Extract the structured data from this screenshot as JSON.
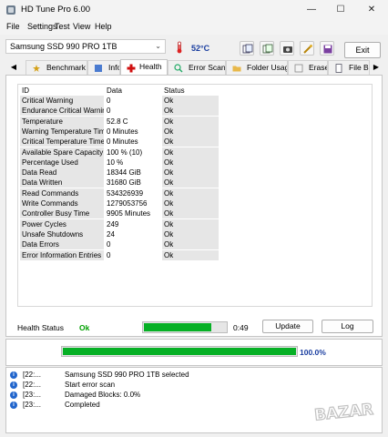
{
  "window": {
    "title": "HD Tune Pro 6.00",
    "controls": [
      "—",
      "☐",
      "✕"
    ]
  },
  "menu": [
    "File",
    "Settings",
    "Test",
    "View",
    "Help"
  ],
  "toolbar": {
    "drive": "Samsung SSD 990 PRO 1TB",
    "temperature": "52°C",
    "exit_label": "Exit",
    "buttons": [
      "copy-info-icon",
      "copy-screen-icon",
      "screenshot-icon",
      "options-icon",
      "save-icon"
    ]
  },
  "tabs": [
    {
      "label": "Benchmark",
      "icon": "benchmark-icon"
    },
    {
      "label": "Info",
      "icon": "info-icon"
    },
    {
      "label": "Health",
      "icon": "health-icon",
      "active": true
    },
    {
      "label": "Error Scan",
      "icon": "error-scan-icon"
    },
    {
      "label": "Folder Usage",
      "icon": "folder-icon"
    },
    {
      "label": "Erase",
      "icon": "erase-icon"
    },
    {
      "label": "File B...",
      "icon": "file-benchmark-icon"
    }
  ],
  "health_table": {
    "headers": [
      "ID",
      "Data",
      "Status"
    ],
    "rows": [
      [
        "Critical Warning",
        "0",
        "Ok"
      ],
      [
        "Endurance Critical Warning",
        "0",
        "Ok"
      ],
      [
        "Temperature",
        "52.8 C",
        "Ok"
      ],
      [
        "Warning Temperature Time",
        "0 Minutes",
        "Ok"
      ],
      [
        "Critical Temperature Time",
        "0 Minutes",
        "Ok"
      ],
      [
        "Available Spare Capacity",
        "100 % (10)",
        "Ok"
      ],
      [
        "Percentage Used",
        "10 %",
        "Ok"
      ],
      [
        "Data Read",
        "18344 GiB",
        "Ok"
      ],
      [
        "Data Written",
        "31680 GiB",
        "Ok"
      ],
      [
        "Read Commands",
        "534326939",
        "Ok"
      ],
      [
        "Write Commands",
        "1279053756",
        "Ok"
      ],
      [
        "Controller Busy Time",
        "9905 Minutes",
        "Ok"
      ],
      [
        "Power Cycles",
        "249",
        "Ok"
      ],
      [
        "Unsafe Shutdowns",
        "24",
        "Ok"
      ],
      [
        "Data Errors",
        "0",
        "Ok"
      ],
      [
        "Error Information Entries",
        "0",
        "Ok"
      ]
    ]
  },
  "health_footer": {
    "label": "Health Status",
    "value": "Ok",
    "progress_fraction": 0.8,
    "time": "0:49",
    "update_label": "Update",
    "log_label": "Log"
  },
  "scan_progress": {
    "fraction": 1.0,
    "label": "100.0%"
  },
  "log": [
    {
      "time": "[22:...",
      "message": "Samsung SSD 990 PRO 1TB  selected"
    },
    {
      "time": "[22:...",
      "message": "Start error scan"
    },
    {
      "time": "[23:...",
      "message": "Damaged Blocks: 0.0%"
    },
    {
      "time": "[23:...",
      "message": "Completed"
    }
  ],
  "watermark": "BAZAR",
  "colors": {
    "accent_green": "#06b025",
    "accent_blue": "#1a3ea0",
    "status_ok": "#00a000"
  }
}
